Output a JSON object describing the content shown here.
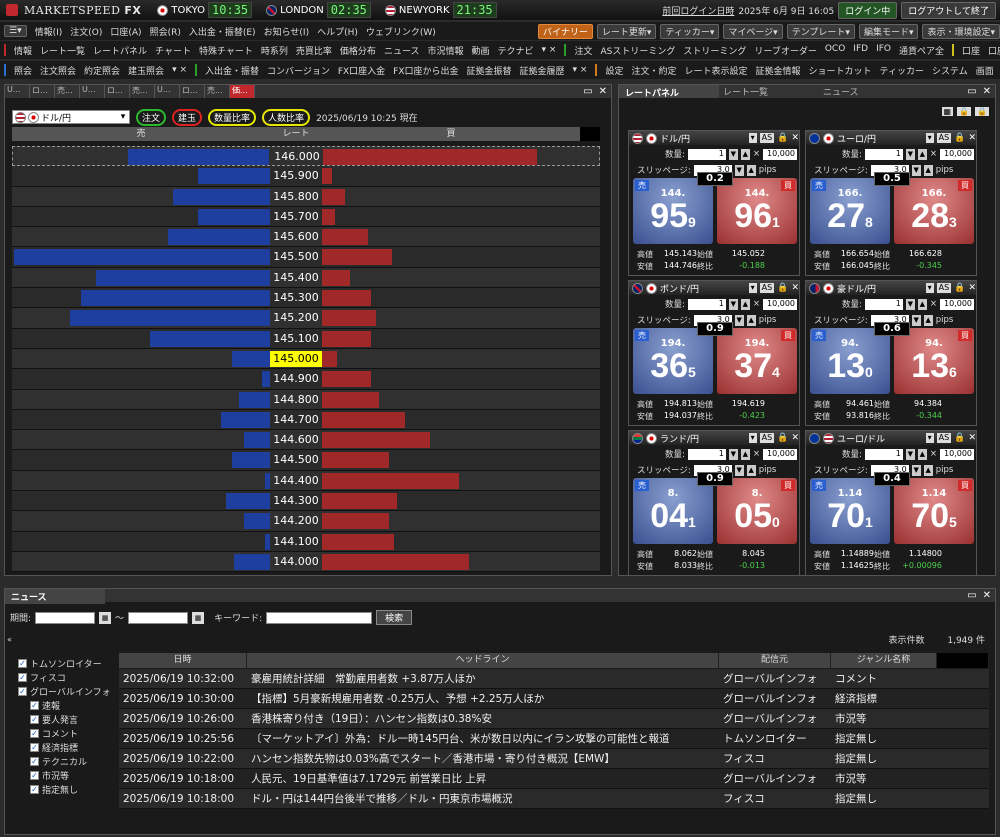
{
  "app": {
    "brand": "MARKETSPEED",
    "brand_suffix": "FX"
  },
  "clocks": [
    {
      "city": "TOKYO",
      "time": "10:35",
      "flag": "jp"
    },
    {
      "city": "LONDON",
      "time": "02:35",
      "flag": "uk"
    },
    {
      "city": "NEWYORK",
      "time": "21:35",
      "flag": "us"
    }
  ],
  "session": {
    "last_login_label": "前回ログイン日時",
    "last_login": "2025年 6月 9日 16:05",
    "status": "ログイン中",
    "logout": "ログアウトして終了"
  },
  "menu_bar": {
    "items": [
      "情報(I)",
      "注文(O)",
      "口座(A)",
      "照会(R)",
      "入出金・振替(E)",
      "お知らせ(I)",
      "ヘルプ(H)",
      "ウェブリンク(W)"
    ],
    "right": [
      "バイナリー",
      "レート更新▾",
      "ティッカー▾",
      "マイページ▾",
      "テンプレート▾",
      "編集モード▾",
      "表示・環境設定▾"
    ]
  },
  "toolbar1": {
    "info_label": "情報",
    "info_items": [
      "レート一覧",
      "レートパネル",
      "チャート",
      "特殊チャート",
      "時系列",
      "売買比率",
      "価格分布",
      "ニュース",
      "市況情報",
      "動画",
      "テクナビ"
    ],
    "order_label": "注文",
    "order_items": [
      "ASストリーミング",
      "ストリーミング",
      "リーブオーダー",
      "OCO",
      "IFD",
      "IFO",
      "通貨ペア全"
    ],
    "account_label": "口座",
    "account_items": [
      "口座情報"
    ]
  },
  "toolbar2": {
    "ref_label": "照会",
    "ref_items": [
      "注文照会",
      "約定照会",
      "建玉照会"
    ],
    "dep_label": "入出金・振替",
    "dep_items": [
      "コンバージョン",
      "FX口座入金",
      "FX口座から出金",
      "証拠金振替",
      "証拠金履歴"
    ],
    "set_label": "設定",
    "set_items": [
      "注文・約定",
      "レート表示設定",
      "証拠金情報",
      "ショートカット",
      "ティッカー",
      "システム",
      "画面"
    ]
  },
  "orderbook": {
    "tabs": [
      "U...",
      "ロ...",
      "売...",
      "U...",
      "ロ...",
      "売...",
      "U...",
      "ロ...",
      "売...",
      "価..."
    ],
    "pair": "ドル/円",
    "buttons": [
      "注文",
      "建玉",
      "数量比率",
      "人数比率"
    ],
    "timestamp": "2025/06/19 10:25 現在",
    "col_sell": "売",
    "col_rate": "レート",
    "col_buy": "買",
    "rows": [
      {
        "rate": "146.000",
        "sell": 0.55,
        "buy": 0.83
      },
      {
        "rate": "145.900",
        "sell": 0.28,
        "buy": 0.04
      },
      {
        "rate": "145.800",
        "sell": 0.38,
        "buy": 0.09
      },
      {
        "rate": "145.700",
        "sell": 0.28,
        "buy": 0.05
      },
      {
        "rate": "145.600",
        "sell": 0.4,
        "buy": 0.18
      },
      {
        "rate": "145.500",
        "sell": 1.0,
        "buy": 0.27
      },
      {
        "rate": "145.400",
        "sell": 0.68,
        "buy": 0.11
      },
      {
        "rate": "145.300",
        "sell": 0.74,
        "buy": 0.19
      },
      {
        "rate": "145.200",
        "sell": 0.78,
        "buy": 0.21
      },
      {
        "rate": "145.100",
        "sell": 0.47,
        "buy": 0.19
      },
      {
        "rate": "145.000",
        "sell": 0.15,
        "buy": 0.06,
        "highlight": true
      },
      {
        "rate": "144.900",
        "sell": 0.03,
        "buy": 0.19
      },
      {
        "rate": "144.800",
        "sell": 0.12,
        "buy": 0.22
      },
      {
        "rate": "144.700",
        "sell": 0.19,
        "buy": 0.32
      },
      {
        "rate": "144.600",
        "sell": 0.1,
        "buy": 0.42
      },
      {
        "rate": "144.500",
        "sell": 0.15,
        "buy": 0.26
      },
      {
        "rate": "144.400",
        "sell": 0.02,
        "buy": 0.53
      },
      {
        "rate": "144.300",
        "sell": 0.17,
        "buy": 0.29
      },
      {
        "rate": "144.200",
        "sell": 0.1,
        "buy": 0.26
      },
      {
        "rate": "144.100",
        "sell": 0.02,
        "buy": 0.28
      },
      {
        "rate": "144.000",
        "sell": 0.14,
        "buy": 0.57
      }
    ]
  },
  "ratepanel": {
    "tabs": [
      "レートパネル",
      "レート一覧",
      "ニュース"
    ],
    "labels": {
      "qty": "数量:",
      "slip": "スリッページ:",
      "pips": "pips",
      "as": "AS",
      "sell": "売",
      "buy": "買",
      "high": "高値",
      "low": "安値",
      "open": "始値",
      "close": "終比"
    },
    "cards": [
      {
        "pair": "ドル/円",
        "flags": [
          "us",
          "jp"
        ],
        "qty": "1",
        "max": "10,000",
        "slip": "3.0",
        "spread": "0.2",
        "sell_pre": "144.",
        "sell_big": "95",
        "sell_small": "9",
        "buy_pre": "144.",
        "buy_big": "96",
        "buy_small": "1",
        "high": "145.143",
        "low": "144.746",
        "open": "145.052",
        "chg": "-0.188"
      },
      {
        "pair": "ユーロ/円",
        "flags": [
          "eu",
          "jp"
        ],
        "qty": "1",
        "max": "10,000",
        "slip": "3.0",
        "spread": "0.5",
        "sell_pre": "166.",
        "sell_big": "27",
        "sell_small": "8",
        "buy_pre": "166.",
        "buy_big": "28",
        "buy_small": "3",
        "high": "166.654",
        "low": "166.045",
        "open": "166.628",
        "chg": "-0.345"
      },
      {
        "pair": "ポンド/円",
        "flags": [
          "uk",
          "jp"
        ],
        "qty": "1",
        "max": "10,000",
        "slip": "3.0",
        "spread": "0.9",
        "sell_pre": "194.",
        "sell_big": "36",
        "sell_small": "5",
        "buy_pre": "194.",
        "buy_big": "37",
        "buy_small": "4",
        "high": "194.813",
        "low": "194.037",
        "open": "194.619",
        "chg": "-0.423"
      },
      {
        "pair": "豪ドル/円",
        "flags": [
          "au",
          "jp"
        ],
        "qty": "1",
        "max": "10,000",
        "slip": "3.0",
        "spread": "0.6",
        "sell_pre": "94.",
        "sell_big": "13",
        "sell_small": "0",
        "buy_pre": "94.",
        "buy_big": "13",
        "buy_small": "6",
        "high": "94.461",
        "low": "93.816",
        "open": "94.384",
        "chg": "-0.344"
      },
      {
        "pair": "ランド/円",
        "flags": [
          "za",
          "jp"
        ],
        "qty": "1",
        "max": "10,000",
        "slip": "3.0",
        "spread": "0.9",
        "sell_pre": "8.",
        "sell_big": "04",
        "sell_small": "1",
        "buy_pre": "8.",
        "buy_big": "05",
        "buy_small": "0",
        "high": "8.062",
        "low": "8.033",
        "open": "8.045",
        "chg": "-0.013"
      },
      {
        "pair": "ユーロ/ドル",
        "flags": [
          "eu",
          "us"
        ],
        "qty": "1",
        "max": "10,000",
        "slip": "3.0",
        "spread": "0.4",
        "sell_pre": "1.14",
        "sell_big": "70",
        "sell_small": "1",
        "buy_pre": "1.14",
        "buy_big": "70",
        "buy_small": "5",
        "high": "1.14889",
        "low": "1.14625",
        "open": "1.14800",
        "chg": "+0.00096"
      }
    ]
  },
  "news": {
    "tab": "ニュース",
    "period_label": "期間:",
    "tilde": "～",
    "keyword_label": "キーワード:",
    "search": "検索",
    "count_label": "表示件数",
    "count": "1,949 件",
    "cols": [
      "日時",
      "ヘッドライン",
      "配信元",
      "ジャンル名称"
    ],
    "tree": [
      {
        "label": "トムソンロイター",
        "level": 0
      },
      {
        "label": "フィスコ",
        "level": 0
      },
      {
        "label": "グローバルインフォ",
        "level": 0
      },
      {
        "label": "速報",
        "level": 1
      },
      {
        "label": "要人発言",
        "level": 1
      },
      {
        "label": "コメント",
        "level": 1
      },
      {
        "label": "経済指標",
        "level": 1
      },
      {
        "label": "テクニカル",
        "level": 1
      },
      {
        "label": "市況等",
        "level": 1
      },
      {
        "label": "指定無し",
        "level": 1
      }
    ],
    "rows": [
      {
        "time": "2025/06/19 10:32:00",
        "headline": "豪雇用統計詳細　常勤雇用者数 +3.87万人ほか",
        "source": "グローバルインフォ",
        "genre": "コメント"
      },
      {
        "time": "2025/06/19 10:30:00",
        "headline": "【指標】5月豪新規雇用者数 -0.25万人、予想 +2.25万人ほか",
        "source": "グローバルインフォ",
        "genre": "経済指標"
      },
      {
        "time": "2025/06/19 10:26:00",
        "headline": "香港株寄り付き（19日）：ハンセン指数は0.38%安",
        "source": "グローバルインフォ",
        "genre": "市況等"
      },
      {
        "time": "2025/06/19 10:25:56",
        "headline": "〔マーケットアイ〕外為：ドル一時145円台、米が数日以内にイラン攻撃の可能性と報道",
        "source": "トムソンロイター",
        "genre": "指定無し"
      },
      {
        "time": "2025/06/19 10:22:00",
        "headline": "ハンセン指数先物は0.03%高でスタート／香港市場・寄り付き概況【EMW】",
        "source": "フィスコ",
        "genre": "指定無し"
      },
      {
        "time": "2025/06/19 10:18:00",
        "headline": "人民元、19日基準値は7.1729元 前営業日比 上昇",
        "source": "グローバルインフォ",
        "genre": "市況等"
      },
      {
        "time": "2025/06/19 10:18:00",
        "headline": "ドル・円は144円台後半で推移／ドル・円東京市場概況",
        "source": "フィスコ",
        "genre": "指定無し"
      }
    ]
  }
}
